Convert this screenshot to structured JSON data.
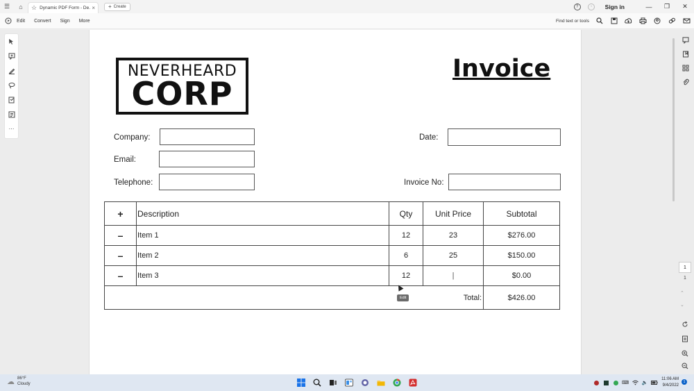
{
  "titlebar": {
    "tab_label": "Dynamic PDF Form - De...",
    "new_tab_label": "Create",
    "sign_in": "Sign in"
  },
  "menubar": {
    "items": [
      "Edit",
      "Convert",
      "Sign",
      "More"
    ],
    "find_label": "Find text or tools"
  },
  "document": {
    "logo_line1": "NEVERHEARD",
    "logo_line2": "CORP",
    "title": "Invoice",
    "fields": {
      "company_label": "Company:",
      "email_label": "Email:",
      "telephone_label": "Telephone:",
      "date_label": "Date:",
      "invoice_no_label": "Invoice No:"
    },
    "table": {
      "add_sign": "+",
      "headers": {
        "description": "Description",
        "qty": "Qty",
        "unit_price": "Unit Price",
        "subtotal": "Subtotal"
      },
      "rows": [
        {
          "remove_sign": "–",
          "description": "Item 1",
          "qty": "12",
          "unit_price": "23",
          "subtotal": "$276.00"
        },
        {
          "remove_sign": "–",
          "description": "Item 2",
          "qty": "6",
          "unit_price": "25",
          "subtotal": "$150.00"
        },
        {
          "remove_sign": "–",
          "description": "Item 3",
          "qty": "12",
          "unit_price": "|",
          "subtotal": "$0.00"
        }
      ],
      "total_label": "Total:",
      "total_value": "$426.00"
    },
    "cursor_tooltip": "Edit"
  },
  "right_rail": {
    "current_page": "1",
    "total_pages": "1"
  },
  "taskbar": {
    "weather_temp": "86°F",
    "weather_desc": "Cloudy",
    "time": "11:06 AM",
    "date": "9/4/2022",
    "notification_count": "1"
  }
}
